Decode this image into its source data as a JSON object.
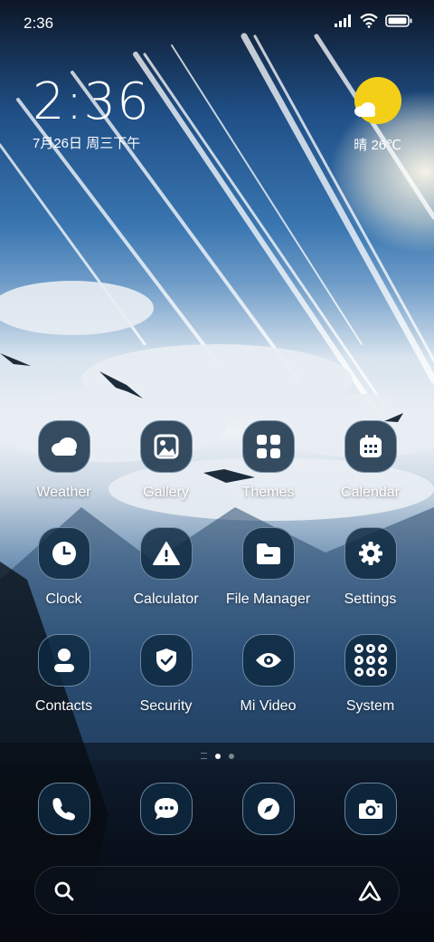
{
  "status_bar": {
    "time": "2:36"
  },
  "clock_widget": {
    "time": "2:36",
    "date": "7月26日 周三下午"
  },
  "weather_widget": {
    "text": "晴 26℃"
  },
  "apps": [
    {
      "label": "Weather",
      "icon": "cloud-icon"
    },
    {
      "label": "Gallery",
      "icon": "image-icon"
    },
    {
      "label": "Themes",
      "icon": "grid-icon"
    },
    {
      "label": "Calendar",
      "icon": "calendar-icon"
    },
    {
      "label": "Clock",
      "icon": "clock-icon"
    },
    {
      "label": "Calculator",
      "icon": "warning-icon"
    },
    {
      "label": "File Manager",
      "icon": "folder-icon"
    },
    {
      "label": "Settings",
      "icon": "gear-icon"
    },
    {
      "label": "Contacts",
      "icon": "person-icon"
    },
    {
      "label": "Security",
      "icon": "shield-icon"
    },
    {
      "label": "Mi Video",
      "icon": "eye-icon"
    },
    {
      "label": "System",
      "icon": "folder-grid-icon"
    }
  ],
  "dock": [
    {
      "icon": "phone-icon"
    },
    {
      "icon": "message-icon"
    },
    {
      "icon": "compass-icon"
    },
    {
      "icon": "camera-icon"
    }
  ],
  "page_indicator": {
    "pages": 2,
    "current": 1
  },
  "colors": {
    "icon_bg": "#0e2840",
    "weather_sun": "#f4cf17"
  }
}
